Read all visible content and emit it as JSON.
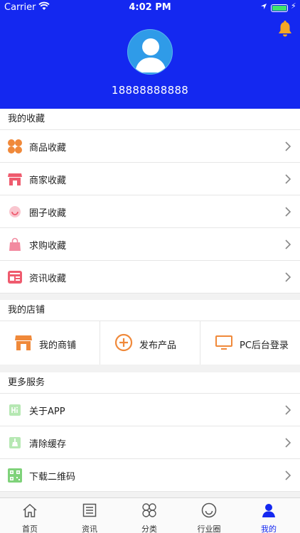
{
  "status_bar": {
    "carrier": "Carrier",
    "time": "4:02 PM"
  },
  "profile": {
    "phone": "18888888888"
  },
  "favorites": {
    "title": "我的收藏",
    "items": [
      {
        "label": "商品收藏",
        "icon": "clover-icon"
      },
      {
        "label": "商家收藏",
        "icon": "store-icon"
      },
      {
        "label": "圈子收藏",
        "icon": "smile-icon"
      },
      {
        "label": "求购收藏",
        "icon": "bag-icon"
      },
      {
        "label": "资讯收藏",
        "icon": "news-card-icon"
      }
    ]
  },
  "shop": {
    "title": "我的店铺",
    "items": [
      {
        "label": "我的商铺",
        "icon": "shop-icon"
      },
      {
        "label": "发布产品",
        "icon": "plus-circle-icon"
      },
      {
        "label": "PC后台登录",
        "icon": "monitor-icon"
      }
    ]
  },
  "services": {
    "title": "更多服务",
    "items": [
      {
        "label": "关于APP",
        "icon": "hi-icon"
      },
      {
        "label": "清除缓存",
        "icon": "broom-icon"
      },
      {
        "label": "下载二维码",
        "icon": "qrcode-icon"
      }
    ]
  },
  "tabbar": {
    "tabs": [
      {
        "label": "首页",
        "icon": "home-icon"
      },
      {
        "label": "资讯",
        "icon": "news-icon"
      },
      {
        "label": "分类",
        "icon": "category-icon"
      },
      {
        "label": "行业圈",
        "icon": "circle-icon"
      },
      {
        "label": "我的",
        "icon": "user-icon",
        "active": true
      }
    ]
  },
  "colors": {
    "primary": "#1428f0",
    "bell": "#f5a623",
    "orange": "#f0893a",
    "red": "#ef5b6e",
    "pink": "#f28aa0",
    "green": "#7fd27a"
  }
}
